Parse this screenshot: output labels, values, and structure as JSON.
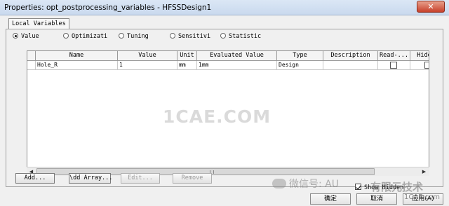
{
  "window": {
    "title": "Properties: opt_postprocessing_variables - HFSSDesign1",
    "close_label": "✕"
  },
  "tabs": [
    "Local Variables"
  ],
  "modes": [
    {
      "label": "Value",
      "selected": true
    },
    {
      "label": "Optimizati",
      "selected": false
    },
    {
      "label": "Tuning",
      "selected": false
    },
    {
      "label": "Sensitivi",
      "selected": false
    },
    {
      "label": "Statistic",
      "selected": false
    }
  ],
  "table": {
    "columns": [
      "",
      "Name",
      "Value",
      "Unit",
      "Evaluated Value",
      "Type",
      "Description",
      "Read-...",
      "Hide"
    ],
    "rows": [
      {
        "name": "Hole_R",
        "value": "1",
        "unit": "mm",
        "evaluated": "1mm",
        "type": "Design",
        "description": "",
        "read_only": false,
        "hidden": false
      }
    ],
    "scroll_grip": "|||"
  },
  "watermark": "1CAE.COM",
  "show_hidden": {
    "label": "Show Hidden",
    "checked": true
  },
  "buttons": {
    "add": "Add...",
    "add_array": "\\dd Array...",
    "edit": "Edit...",
    "remove": "Remove"
  },
  "dialog_buttons": {
    "ok": "确定",
    "cancel": "取消",
    "apply": "应用(A)"
  },
  "overlay": {
    "wechat": "微信号: AU",
    "brand": "有限元技术",
    "site": "1CAE.com"
  },
  "colors": {
    "titlebar": "#c9d9ee",
    "close": "#c7402a",
    "dialog_bg": "#f0f0f0"
  }
}
